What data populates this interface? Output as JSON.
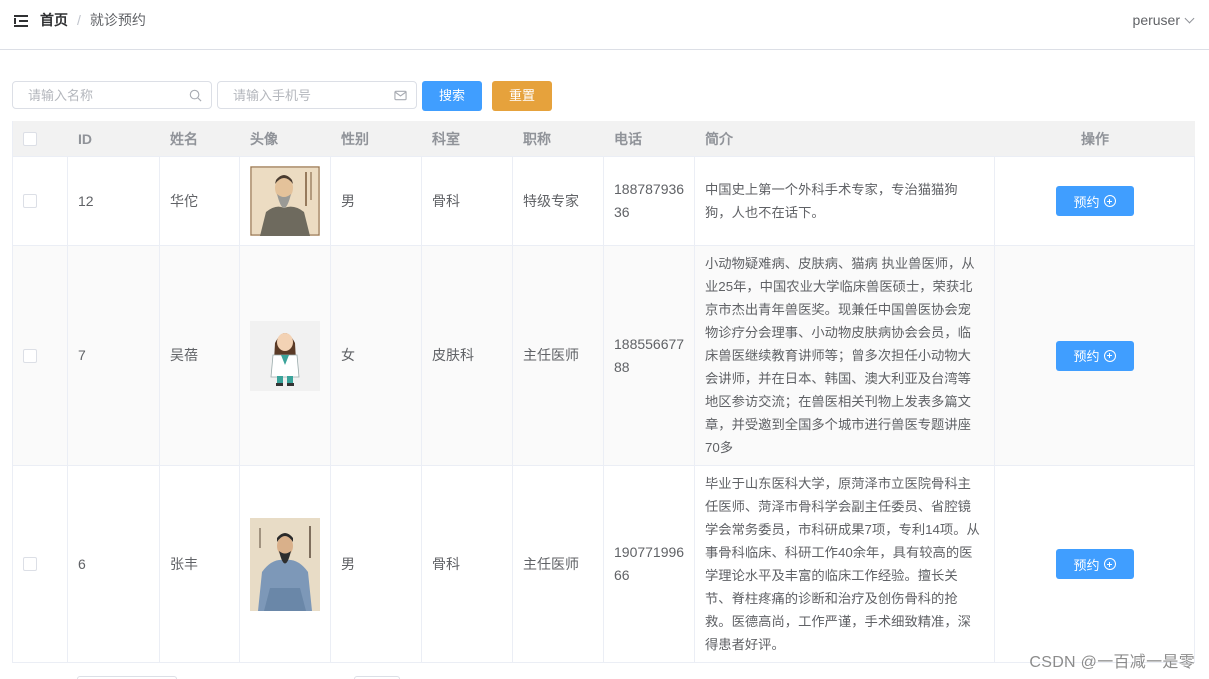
{
  "header": {
    "breadcrumb_home": "首页",
    "breadcrumb_sep": "/",
    "breadcrumb_current": "就诊预约",
    "username": "peruser"
  },
  "search": {
    "name_placeholder": "请输入名称",
    "phone_placeholder": "请输入手机号",
    "search_label": "搜索",
    "reset_label": "重置"
  },
  "table": {
    "columns": [
      "ID",
      "姓名",
      "头像",
      "性别",
      "科室",
      "职称",
      "电话",
      "简介",
      "操作"
    ],
    "rows": [
      {
        "id": "12",
        "name": "华佗",
        "avatar": "portrait-ancient-physician",
        "gender": "男",
        "dept": "骨科",
        "title": "特级专家",
        "phone": "18878793636",
        "intro": "中国史上第一个外科手术专家，专治猫猫狗狗，人也不在话下。",
        "action": "预约"
      },
      {
        "id": "7",
        "name": "吴蓓",
        "avatar": "cartoon-female-doctor",
        "gender": "女",
        "dept": "皮肤科",
        "title": "主任医师",
        "phone": "18855667788",
        "intro": "小动物疑难病、皮肤病、猫病 执业兽医师，从业25年，中国农业大学临床兽医硕士，荣获北京市杰出青年兽医奖。现兼任中国兽医协会宠物诊疗分会理事、小动物皮肤病协会会员，临床兽医继续教育讲师等；曾多次担任小动物大会讲师，并在日本、韩国、澳大利亚及台湾等地区参访交流；在兽医相关刊物上发表多篇文章，并受邀到全国多个城市进行兽医专题讲座70多",
        "action": "预约"
      },
      {
        "id": "6",
        "name": "张丰",
        "avatar": "portrait-seated-taoist",
        "gender": "男",
        "dept": "骨科",
        "title": "主任医师",
        "phone": "19077199666",
        "intro": "毕业于山东医科大学，原菏泽市立医院骨科主任医师、菏泽市骨科学会副主任委员、省腔镜学会常务委员，市科研成果7项，专利14项。从事骨科临床、科研工作40余年，具有较高的医学理论水平及丰富的临床工作经验。擅长关节、脊柱疼痛的诊断和治疗及创伤骨科的抢救。医德高尚，工作严谨，手术细致精准，深得患者好评。",
        "action": "预约"
      }
    ]
  },
  "watermark": "CSDN @一百减一是零"
}
